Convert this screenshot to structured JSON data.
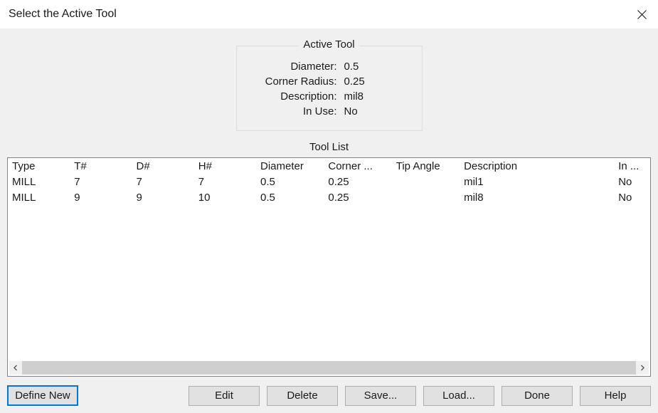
{
  "window": {
    "title": "Select the Active Tool"
  },
  "active_tool": {
    "legend": "Active Tool",
    "labels": {
      "diameter": "Diameter:",
      "corner_radius": "Corner Radius:",
      "description": "Description:",
      "in_use": "In Use:"
    },
    "values": {
      "diameter": "0.5",
      "corner_radius": "0.25",
      "description": "mil8",
      "in_use": "No"
    }
  },
  "tool_list": {
    "heading": "Tool List",
    "columns": {
      "type": "Type",
      "t_no": "T#",
      "d_no": "D#",
      "h_no": "H#",
      "diameter": "Diameter",
      "corner": "Corner ...",
      "tip_angle": "Tip Angle",
      "description": "Description",
      "in_use": "In ..."
    },
    "rows": [
      {
        "type": "MILL",
        "t_no": "7",
        "d_no": "7",
        "h_no": "7",
        "diameter": "0.5",
        "corner": "0.25",
        "tip_angle": "",
        "description": "mil1",
        "in_use": "No"
      },
      {
        "type": "MILL",
        "t_no": "9",
        "d_no": "9",
        "h_no": "10",
        "diameter": "0.5",
        "corner": "0.25",
        "tip_angle": "",
        "description": "mil8",
        "in_use": "No"
      }
    ]
  },
  "buttons": {
    "define_new": "Define New",
    "edit": "Edit",
    "delete": "Delete",
    "save": "Save...",
    "load": "Load...",
    "done": "Done",
    "help": "Help"
  }
}
